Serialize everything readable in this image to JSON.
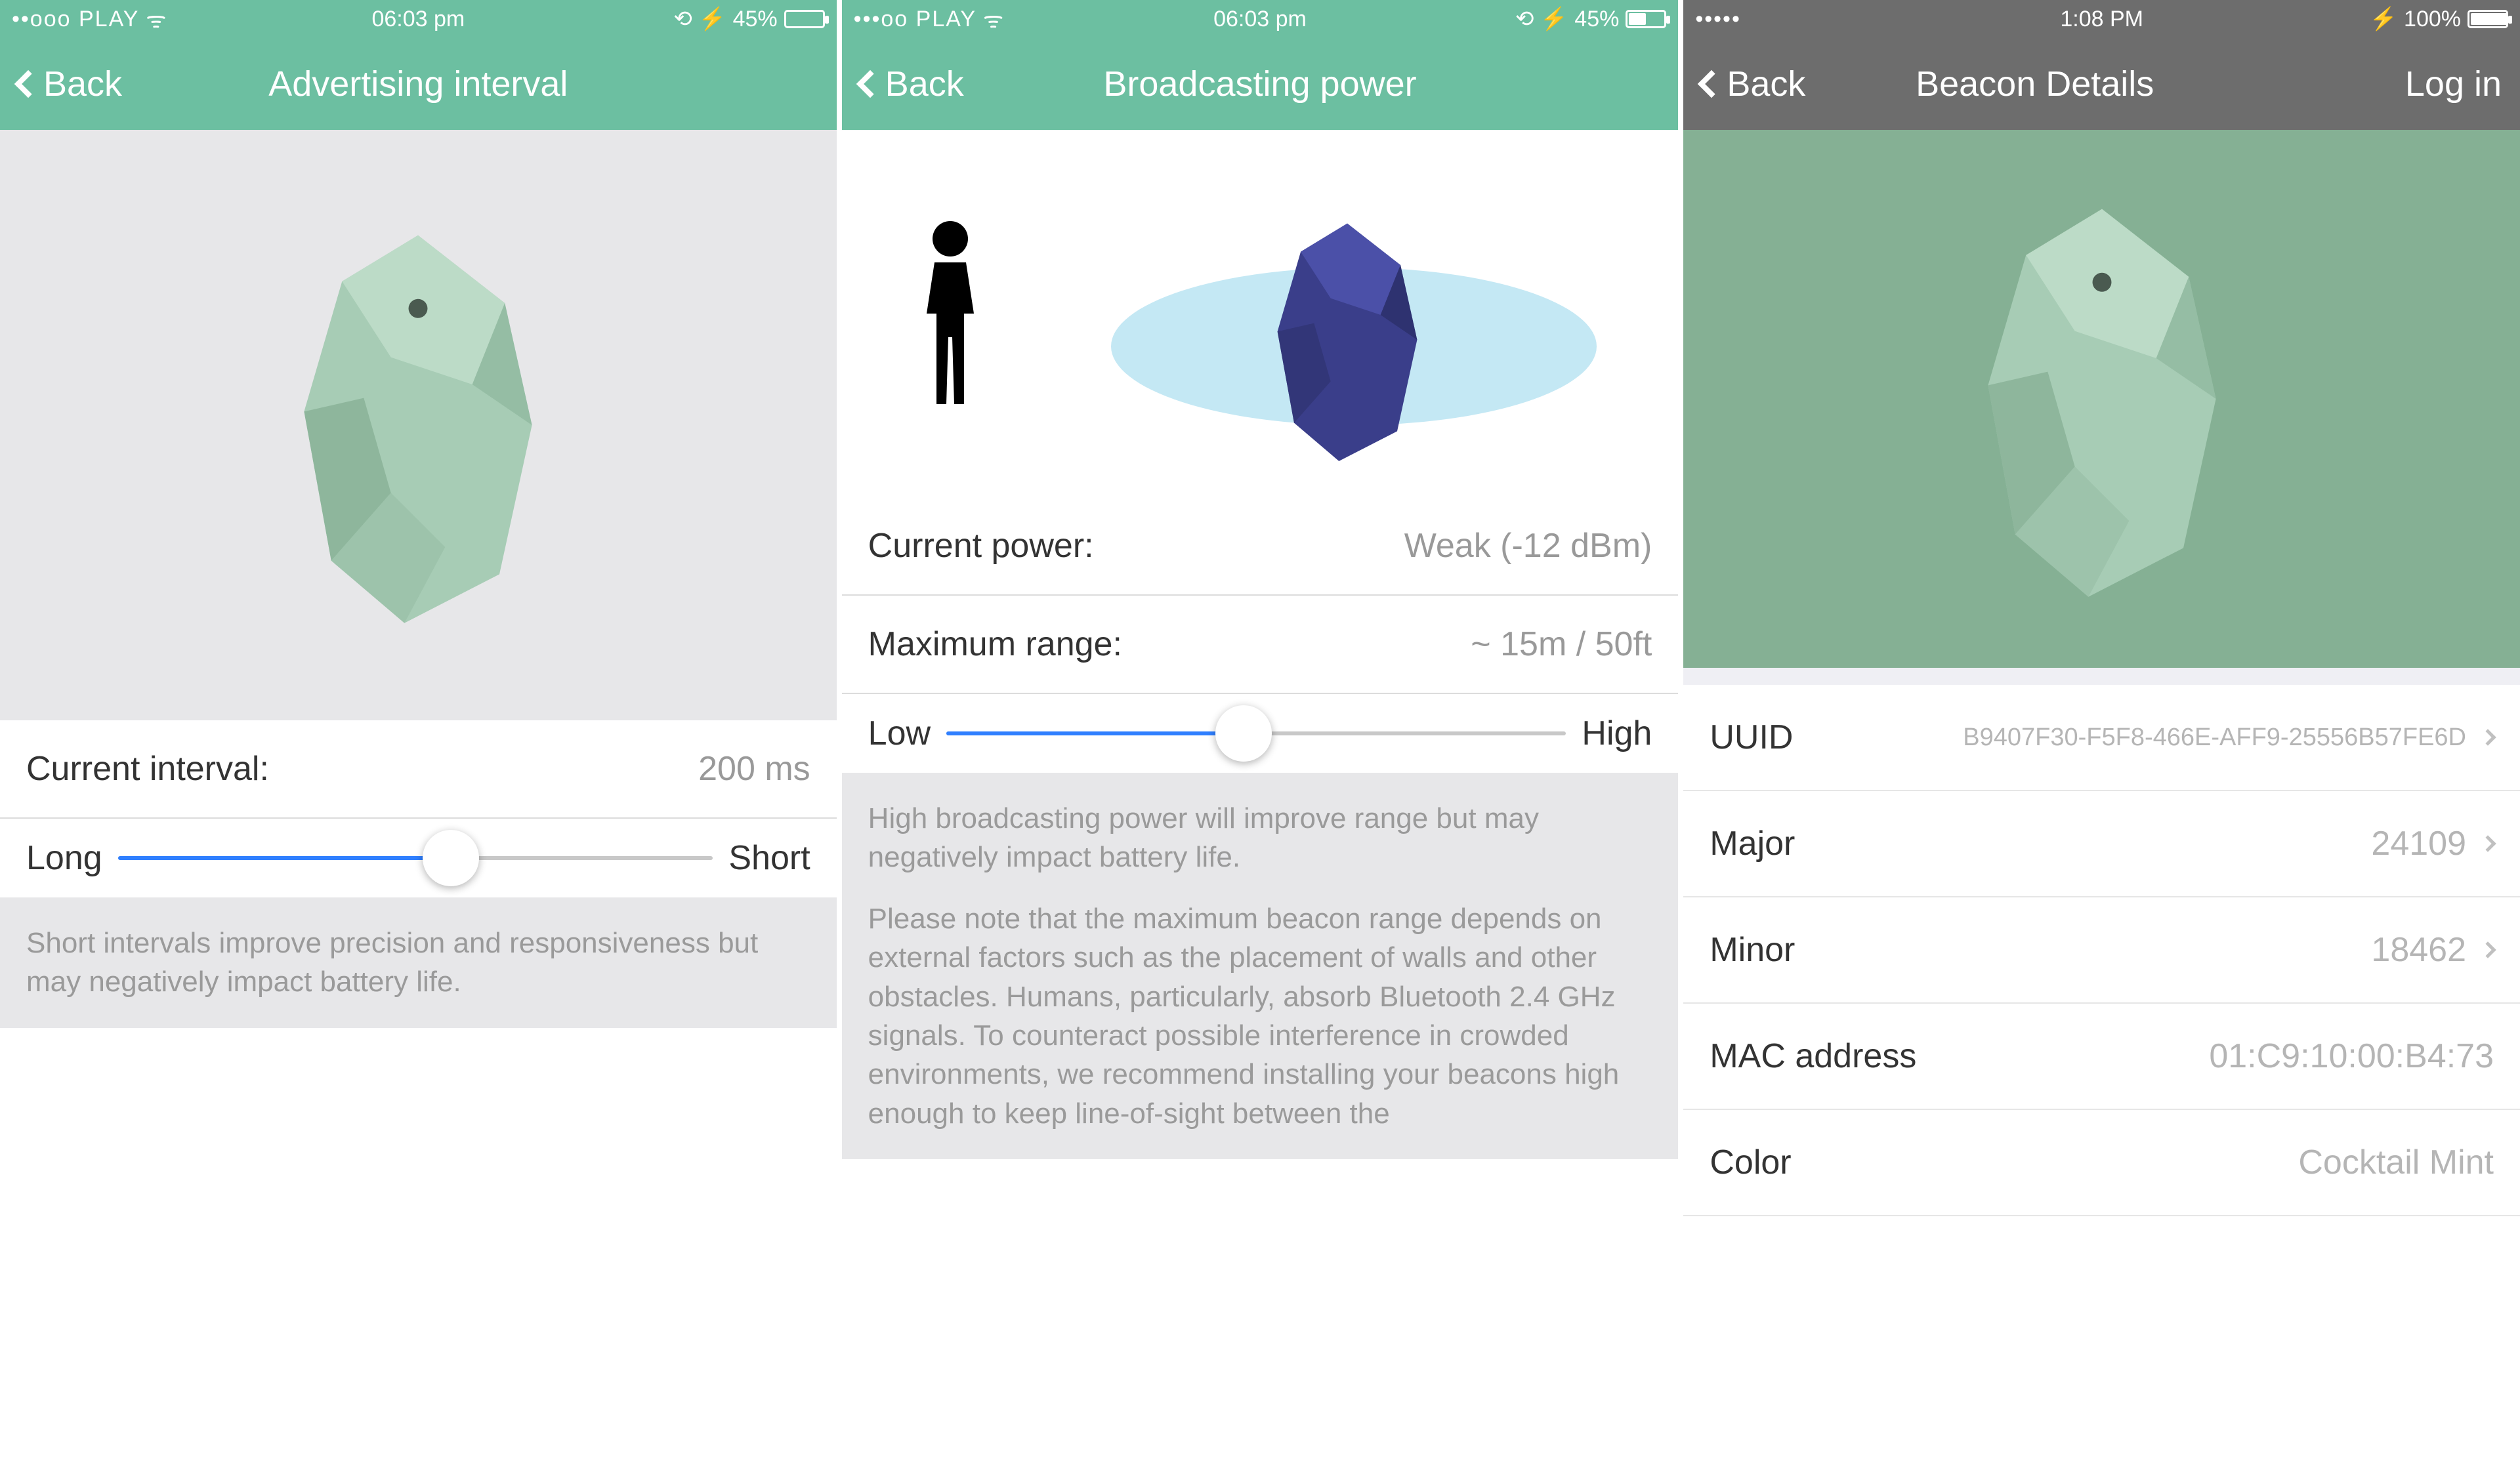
{
  "screen1": {
    "status": {
      "carrier": "••ooo PLAY",
      "wifi": "ᯤ",
      "time": "06:03 pm",
      "extras": "⟲ ⚡",
      "battery": "45%",
      "battery_fill": "45%"
    },
    "nav": {
      "back": "Back",
      "title": "Advertising interval"
    },
    "hero_beacon_color": "mint",
    "current_label": "Current interval:",
    "current_value": "200 ms",
    "slider": {
      "min_label": "Long",
      "max_label": "Short",
      "fill": "56%"
    },
    "help": "Short intervals improve precision and responsiveness but may negatively impact battery life."
  },
  "screen2": {
    "status": {
      "carrier": "•••oo PLAY",
      "wifi": "ᯤ",
      "time": "06:03 pm",
      "extras": "⟲ ⚡",
      "battery": "45%",
      "battery_fill": "45%"
    },
    "nav": {
      "back": "Back",
      "title": "Broadcasting power"
    },
    "power_label": "Current power:",
    "power_value": "Weak (-12 dBm)",
    "range_label": "Maximum range:",
    "range_value": "~ 15m / 50ft",
    "slider": {
      "min_label": "Low",
      "max_label": "High",
      "fill": "48%"
    },
    "help1": "High broadcasting power will improve range but may negatively impact battery life.",
    "help2": "Please note that the maximum beacon range depends on external factors such as the placement of walls and other obstacles. Humans, particularly, absorb Bluetooth 2.4 GHz signals. To counteract possible interference in crowded environments, we recommend installing your beacons high enough to keep line-of-sight between the"
  },
  "screen3": {
    "status": {
      "carrier": "•••••",
      "time": "1:08 PM",
      "bt": "⚡",
      "battery": "100%",
      "battery_fill": "100%"
    },
    "nav": {
      "back": "Back",
      "title": "Beacon Details",
      "right": "Log in"
    },
    "rows": {
      "uuid_label": "UUID",
      "uuid_value": "B9407F30-F5F8-466E-AFF9-25556B57FE6D",
      "major_label": "Major",
      "major_value": "24109",
      "minor_label": "Minor",
      "minor_value": "18462",
      "mac_label": "MAC address",
      "mac_value": "01:C9:10:00:B4:73",
      "color_label": "Color",
      "color_value": "Cocktail Mint"
    }
  }
}
